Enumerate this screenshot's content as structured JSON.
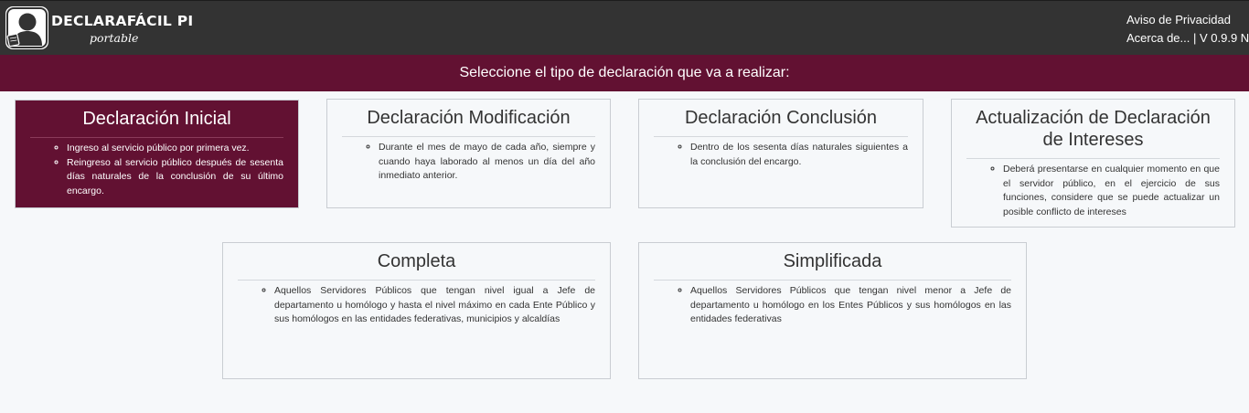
{
  "header": {
    "logo_title": "DECLARAFÁCIL PI",
    "logo_subtitle": "portable",
    "privacy_link": "Aviso de Privacidad",
    "about_link": "Acerca de...",
    "version": " | V 0.9.9 N"
  },
  "banner": "Seleccione el tipo de declaración que va a realizar:",
  "cards": [
    {
      "title": "Declaración Inicial",
      "items": [
        "Ingreso al servicio público por primera vez.",
        "Reingreso al servicio público después de sesenta días naturales de la conclusión de su último encargo."
      ]
    },
    {
      "title": "Declaración Modificación",
      "items": [
        "Durante el mes de mayo de cada año, siempre y cuando haya laborado al menos un día del año inmediato anterior."
      ]
    },
    {
      "title": "Declaración Conclusión",
      "items": [
        "Dentro de los sesenta días naturales siguientes a la conclusión del encargo."
      ]
    },
    {
      "title": "Actualización de Declaración de Intereses",
      "items": [
        "Deberá presentarse en cualquier momento en que el servidor público, en el ejercicio de sus funciones, considere que se puede actualizar un posible conflicto de intereses"
      ]
    },
    {
      "title": "Completa",
      "items": [
        "Aquellos Servidores Públicos que tengan nivel igual a Jefe de departamento u homólogo y hasta el nivel máximo en cada Ente Público y sus homólogos en las entidades federativas, municipios y alcaldías"
      ]
    },
    {
      "title": "Simplificada",
      "items": [
        "Aquellos Servidores Públicos que tengan nivel menor a Jefe de departamento u homólogo en los Entes Públicos y sus homólogos en las entidades federativas"
      ]
    }
  ],
  "colors": {
    "topbar": "#333333",
    "brand": "#621132",
    "background": "#f6f8fa"
  }
}
